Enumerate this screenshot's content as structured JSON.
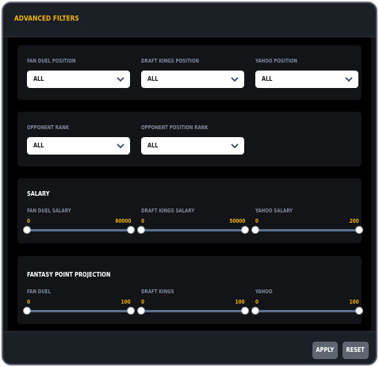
{
  "title": "ADVANCED FILTERS",
  "positions": {
    "fanduel_label": "FAN DUEL POSITION",
    "fanduel_value": "ALL",
    "draftkings_label": "DRAFT KINGS POSITION",
    "draftkings_value": "ALL",
    "yahoo_label": "YAHOO POSITION",
    "yahoo_value": "ALL"
  },
  "opponent": {
    "rank_label": "OPPONENT RANK",
    "rank_value": "ALL",
    "position_rank_label": "OPPONENT POSITION RANK",
    "position_rank_value": "ALL"
  },
  "salary": {
    "title": "SALARY",
    "fanduel": {
      "label": "FAN DUEL SALARY",
      "min": "0",
      "max": "60000"
    },
    "draftkings": {
      "label": "DRAFT KINGS SALARY",
      "min": "0",
      "max": "50000"
    },
    "yahoo": {
      "label": "YAHOO SALARY",
      "min": "0",
      "max": "200"
    }
  },
  "projection": {
    "title": "FANTASY POINT PROJECTION",
    "fanduel": {
      "label": "FAN DUEL",
      "min": "0",
      "max": "100"
    },
    "draftkings": {
      "label": "DRAFT KINGS",
      "min": "0",
      "max": "100"
    },
    "yahoo": {
      "label": "YAHOO",
      "min": "0",
      "max": "100"
    }
  },
  "footer": {
    "apply_label": "APPLY",
    "reset_label": "RESET"
  },
  "colors": {
    "accent": "#f2b20f",
    "panel": "#121418",
    "track": "#5c6f8e"
  },
  "icons": {
    "dropdown": "chevron-down-icon"
  }
}
